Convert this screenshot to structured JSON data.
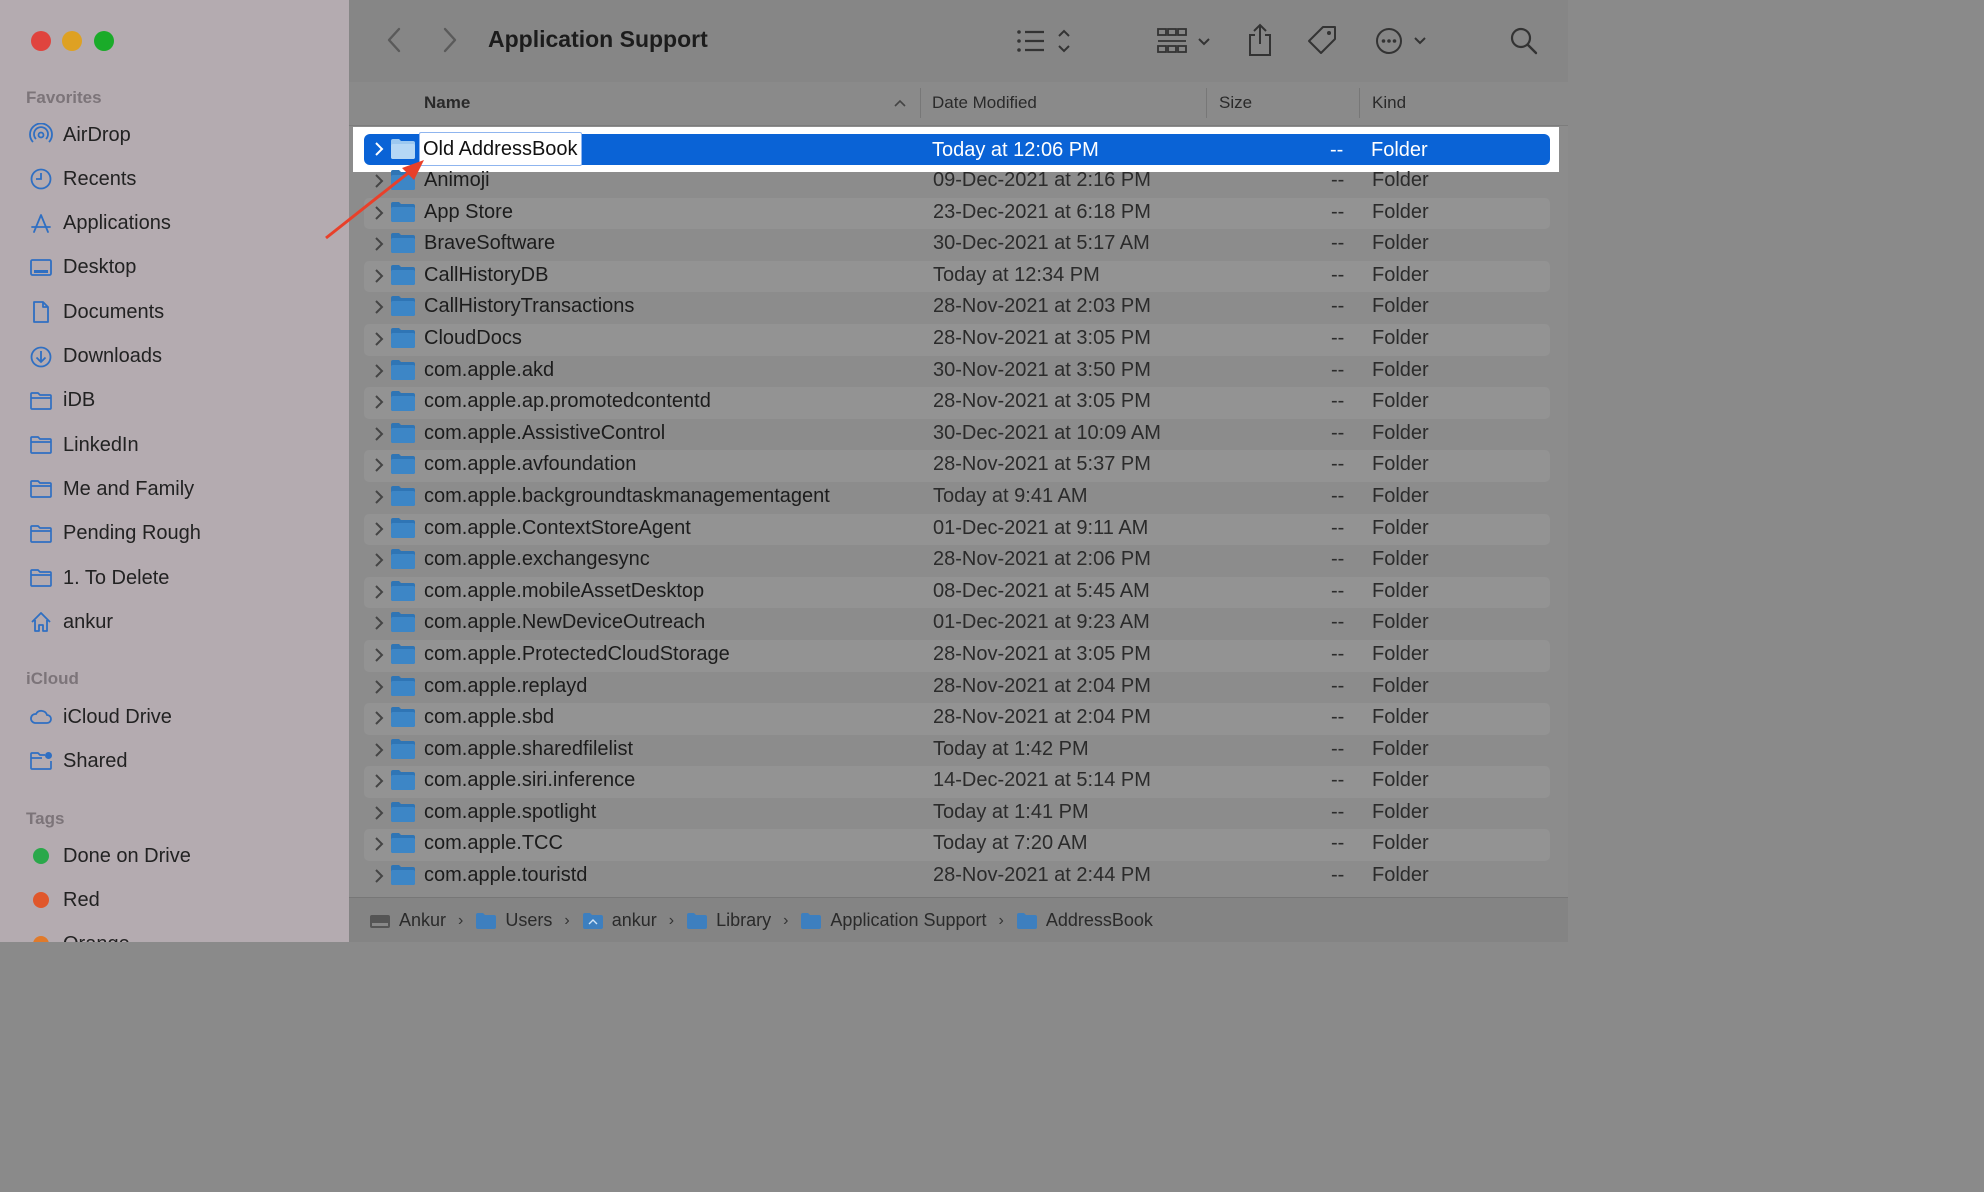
{
  "window": {
    "title": "Application Support"
  },
  "traffic_lights": {
    "close": "#e0443e",
    "minimize": "#dea123",
    "zoom": "#1aab29"
  },
  "sidebar": {
    "favorites_label": "Favorites",
    "favorites": [
      {
        "label": "AirDrop",
        "icon": "airdrop-icon"
      },
      {
        "label": "Recents",
        "icon": "clock-icon"
      },
      {
        "label": "Applications",
        "icon": "applications-icon"
      },
      {
        "label": "Desktop",
        "icon": "desktop-icon"
      },
      {
        "label": "Documents",
        "icon": "document-icon"
      },
      {
        "label": "Downloads",
        "icon": "download-icon"
      },
      {
        "label": "iDB",
        "icon": "folder-icon"
      },
      {
        "label": "LinkedIn",
        "icon": "folder-icon"
      },
      {
        "label": "Me and Family",
        "icon": "folder-icon"
      },
      {
        "label": "Pending Rough",
        "icon": "folder-icon"
      },
      {
        "label": "1. To Delete",
        "icon": "folder-icon"
      },
      {
        "label": "ankur",
        "icon": "home-icon"
      }
    ],
    "icloud_label": "iCloud",
    "icloud": [
      {
        "label": "iCloud Drive",
        "icon": "cloud-icon"
      },
      {
        "label": "Shared",
        "icon": "shared-folder-icon"
      }
    ],
    "tags_label": "Tags",
    "tags": [
      {
        "label": "Done on Drive",
        "color": "#2aa84a"
      },
      {
        "label": "Red",
        "color": "#e0572b"
      },
      {
        "label": "Orange",
        "color": "#e07a2b"
      }
    ]
  },
  "columns": {
    "name": "Name",
    "date": "Date Modified",
    "size": "Size",
    "kind": "Kind"
  },
  "selected_row": {
    "name": "Old AddressBook",
    "date": "Today at 12:06 PM",
    "size": "--",
    "kind": "Folder"
  },
  "rows": [
    {
      "name": "Animoji",
      "date": "09-Dec-2021 at 2:16 PM",
      "size": "--",
      "kind": "Folder"
    },
    {
      "name": "App Store",
      "date": "23-Dec-2021 at 6:18 PM",
      "size": "--",
      "kind": "Folder"
    },
    {
      "name": "BraveSoftware",
      "date": "30-Dec-2021 at 5:17 AM",
      "size": "--",
      "kind": "Folder"
    },
    {
      "name": "CallHistoryDB",
      "date": "Today at 12:34 PM",
      "size": "--",
      "kind": "Folder"
    },
    {
      "name": "CallHistoryTransactions",
      "date": "28-Nov-2021 at 2:03 PM",
      "size": "--",
      "kind": "Folder"
    },
    {
      "name": "CloudDocs",
      "date": "28-Nov-2021 at 3:05 PM",
      "size": "--",
      "kind": "Folder"
    },
    {
      "name": "com.apple.akd",
      "date": "30-Nov-2021 at 3:50 PM",
      "size": "--",
      "kind": "Folder"
    },
    {
      "name": "com.apple.ap.promotedcontentd",
      "date": "28-Nov-2021 at 3:05 PM",
      "size": "--",
      "kind": "Folder"
    },
    {
      "name": "com.apple.AssistiveControl",
      "date": "30-Dec-2021 at 10:09 AM",
      "size": "--",
      "kind": "Folder"
    },
    {
      "name": "com.apple.avfoundation",
      "date": "28-Nov-2021 at 5:37 PM",
      "size": "--",
      "kind": "Folder"
    },
    {
      "name": "com.apple.backgroundtaskmanagementagent",
      "date": "Today at 9:41 AM",
      "size": "--",
      "kind": "Folder"
    },
    {
      "name": "com.apple.ContextStoreAgent",
      "date": "01-Dec-2021 at 9:11 AM",
      "size": "--",
      "kind": "Folder"
    },
    {
      "name": "com.apple.exchangesync",
      "date": "28-Nov-2021 at 2:06 PM",
      "size": "--",
      "kind": "Folder"
    },
    {
      "name": "com.apple.mobileAssetDesktop",
      "date": "08-Dec-2021 at 5:45 AM",
      "size": "--",
      "kind": "Folder"
    },
    {
      "name": "com.apple.NewDeviceOutreach",
      "date": "01-Dec-2021 at 9:23 AM",
      "size": "--",
      "kind": "Folder"
    },
    {
      "name": "com.apple.ProtectedCloudStorage",
      "date": "28-Nov-2021 at 3:05 PM",
      "size": "--",
      "kind": "Folder"
    },
    {
      "name": "com.apple.replayd",
      "date": "28-Nov-2021 at 2:04 PM",
      "size": "--",
      "kind": "Folder"
    },
    {
      "name": "com.apple.sbd",
      "date": "28-Nov-2021 at 2:04 PM",
      "size": "--",
      "kind": "Folder"
    },
    {
      "name": "com.apple.sharedfilelist",
      "date": "Today at 1:42 PM",
      "size": "--",
      "kind": "Folder"
    },
    {
      "name": "com.apple.siri.inference",
      "date": "14-Dec-2021 at 5:14 PM",
      "size": "--",
      "kind": "Folder"
    },
    {
      "name": "com.apple.spotlight",
      "date": "Today at 1:41 PM",
      "size": "--",
      "kind": "Folder"
    },
    {
      "name": "com.apple.TCC",
      "date": "Today at 7:20 AM",
      "size": "--",
      "kind": "Folder"
    },
    {
      "name": "com.apple.touristd",
      "date": "28-Nov-2021 at 2:44 PM",
      "size": "--",
      "kind": "Folder"
    }
  ],
  "path_bar": [
    {
      "label": "Ankur",
      "icon": "disk-icon"
    },
    {
      "label": "Users",
      "icon": "folder-icon"
    },
    {
      "label": "ankur",
      "icon": "home-folder-icon"
    },
    {
      "label": "Library",
      "icon": "folder-icon"
    },
    {
      "label": "Application Support",
      "icon": "folder-icon"
    },
    {
      "label": "AddressBook",
      "icon": "folder-icon"
    }
  ],
  "accent_colors": {
    "selection": "#0a63d6",
    "annotation_arrow": "#e8402a",
    "folder": "#3d86c6"
  }
}
